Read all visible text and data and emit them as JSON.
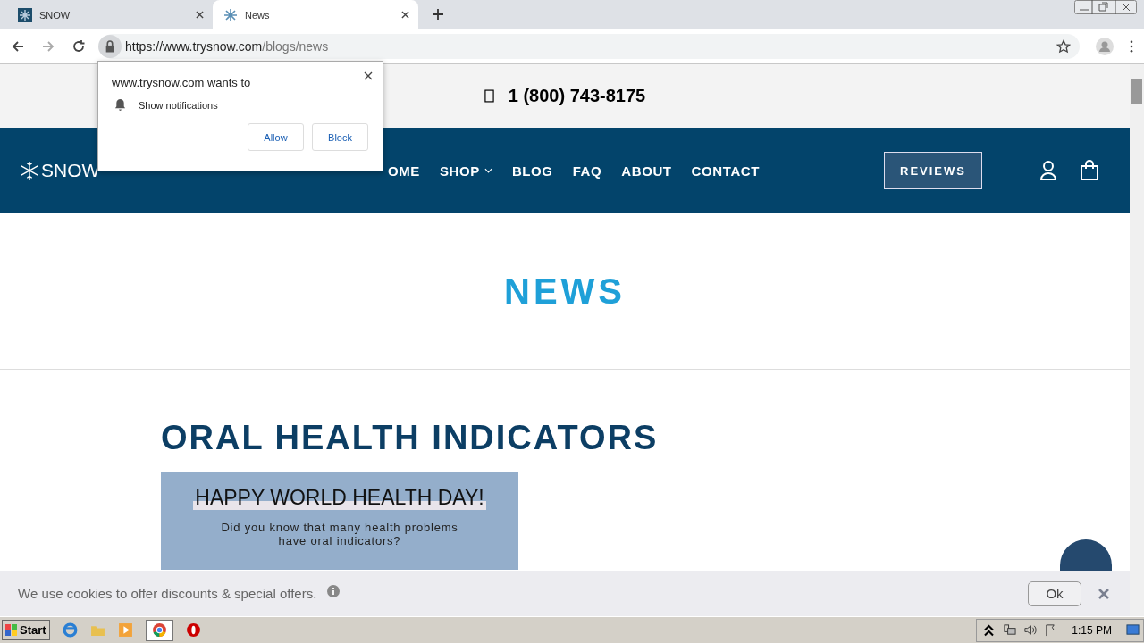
{
  "browser": {
    "tabs": [
      {
        "title": "SNOW",
        "selected": false
      },
      {
        "title": "News",
        "selected": true
      }
    ],
    "address": {
      "host": "https://www.trysnow.com",
      "path": "/blogs/news"
    }
  },
  "permission_popup": {
    "title": "www.trysnow.com wants to",
    "permission": "Show notifications",
    "buttons": [
      "Allow",
      "Block"
    ]
  },
  "top_bar": {
    "phone": "1 (800) 743-8175"
  },
  "nav": {
    "logo": "SNOW",
    "items": [
      {
        "label": "OME",
        "dropdown": false
      },
      {
        "label": "SHOP",
        "dropdown": true
      },
      {
        "label": "BLOG",
        "dropdown": false
      },
      {
        "label": "FAQ",
        "dropdown": false
      },
      {
        "label": "ABOUT",
        "dropdown": false
      },
      {
        "label": "CONTACT",
        "dropdown": false
      }
    ],
    "reviews_button": "REVIEWS"
  },
  "page_title": "NEWS",
  "article": {
    "title": "ORAL HEALTH INDICATORS",
    "banner_heading": "HAPPY WORLD HEALTH DAY!",
    "banner_text": "Did you know that many health problems have oral indicators?"
  },
  "cookie_bar": {
    "text": "We use cookies to offer discounts & special offers.",
    "button": "Ok"
  },
  "taskbar": {
    "start": "Start",
    "clock": "1:15 PM"
  }
}
